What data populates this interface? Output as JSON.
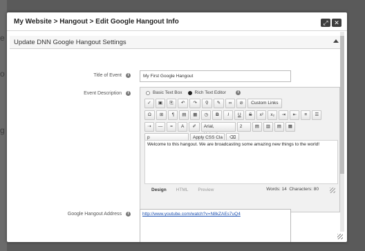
{
  "window": {
    "title": "My Website > Hangout > Edit Google Hangout Info",
    "controls": [
      "maximize",
      "close"
    ]
  },
  "section": {
    "title": "Update DNN Google Hangout Settings"
  },
  "fields": {
    "title_label": "Title of Event",
    "title_value": "My First Google Hangout",
    "description_label": "Event Description",
    "address_label": "Google Hangout Address",
    "address_value": "http://www.youtube.com/watch?v=N8kZAEs7uQ4"
  },
  "editor": {
    "mode_basic": "Basic Text Box",
    "mode_rich": "Rich Text Editor",
    "selected_mode": "Rich Text Editor",
    "custom_links": "Custom Links",
    "font_name": "Arial, Helvetica",
    "font_size": "2",
    "paragraph": "p",
    "apply_css": "Apply CSS Cla",
    "content": "Welcome to this hangout. We are broadcasting some amazing new things to the world!",
    "tabs": [
      "Design",
      "HTML",
      "Preview"
    ],
    "active_tab": "Design",
    "words_label": "Words: 14",
    "chars_label": "Characters: 80",
    "glyphs": {
      "omega": "Ω",
      "pilcrow": "¶",
      "bold": "B",
      "italic": "I",
      "underline": "U",
      "strike": "S",
      "sup": "x²",
      "sub": "x₂",
      "a": "A",
      "undo": "↶",
      "redo": "↷",
      "clock": "◷"
    }
  },
  "colors": {
    "backdrop": "#5a5a5a",
    "dialog": "#ffffff",
    "link": "#1a4fb0"
  }
}
